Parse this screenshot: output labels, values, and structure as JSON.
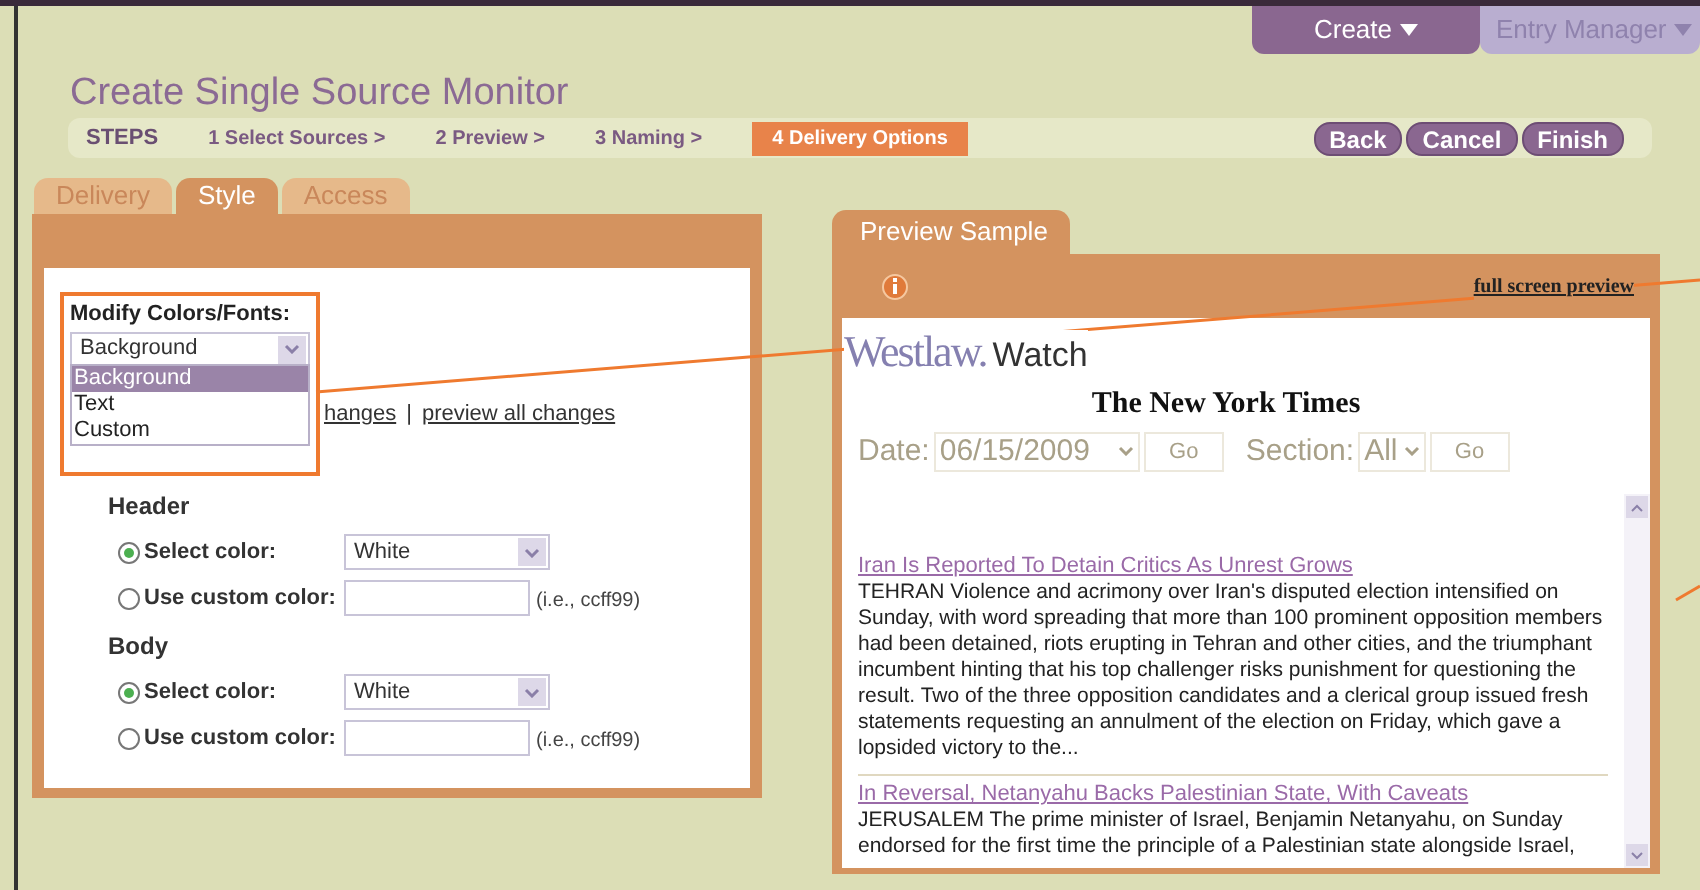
{
  "top_menu": [
    {
      "label": "Create",
      "selected": true
    },
    {
      "label": "Entry Manager",
      "selected": false
    }
  ],
  "page_title": "Create Single Source Monitor",
  "steps": {
    "label": "STEPS",
    "items": [
      {
        "label": "1 Select Sources >",
        "selected": false
      },
      {
        "label": "2 Preview >",
        "selected": false
      },
      {
        "label": "3 Naming >",
        "selected": false
      },
      {
        "label": "4 Delivery Options",
        "selected": true
      }
    ]
  },
  "buttons": [
    "Back",
    "Cancel",
    "Finish"
  ],
  "tabs": [
    {
      "label": "Delivery",
      "selected": false
    },
    {
      "label": "Style",
      "selected": true
    },
    {
      "label": "Access",
      "selected": false
    }
  ],
  "modify": {
    "label": "Modify Colors/Fonts:",
    "value": "Background",
    "expanded": true,
    "options": [
      {
        "label": "Background",
        "selected": true
      },
      {
        "label": "Text",
        "selected": false
      },
      {
        "label": "Custom",
        "selected": false
      }
    ],
    "links": [
      "hanges",
      "preview all changes"
    ],
    "separator": "|"
  },
  "sections": [
    {
      "title": "Header",
      "select_label": "Select color:",
      "select_checked": true,
      "select_value": "White",
      "custom_label": "Use custom color:",
      "custom_checked": false,
      "hint": "(i.e., ccff99)"
    },
    {
      "title": "Body",
      "select_label": "Select color:",
      "select_checked": true,
      "select_value": "White",
      "custom_label": "Use custom color:",
      "custom_checked": false,
      "hint": "(i.e., ccff99)"
    }
  ],
  "preview": {
    "tab": "Preview Sample",
    "full_screen_link": "full screen preview",
    "logo": "Westlaw.",
    "logo_suffix": "Watch",
    "paper": "The New York Times",
    "filters_disabled": true,
    "date_label": "Date:",
    "date_value": "06/15/2009",
    "go": "Go",
    "section_label": "Section:",
    "section_value": "All",
    "go2": "Go",
    "articles": [
      {
        "title": "Iran Is Reported To Detain Critics As Unrest Grows",
        "body": "TEHRAN Violence and acrimony over Iran's disputed election intensified on Sunday, with word spreading that more than 100 prominent opposition members had been detained, riots erupting in Tehran and other cities, and the triumphant incumbent hinting that his top challenger risks punishment for questioning the result. Two of the three opposition candidates and a clerical group issued fresh statements requesting an annulment of the election on Friday, which gave a lopsided victory to the..."
      },
      {
        "title": "In Reversal, Netanyahu Backs Palestinian State, With Caveats",
        "body": "JERUSALEM The prime minister of Israel, Benjamin Netanyahu, on Sunday endorsed for the first time the principle of a Palestinian state alongside Israel,"
      }
    ]
  }
}
